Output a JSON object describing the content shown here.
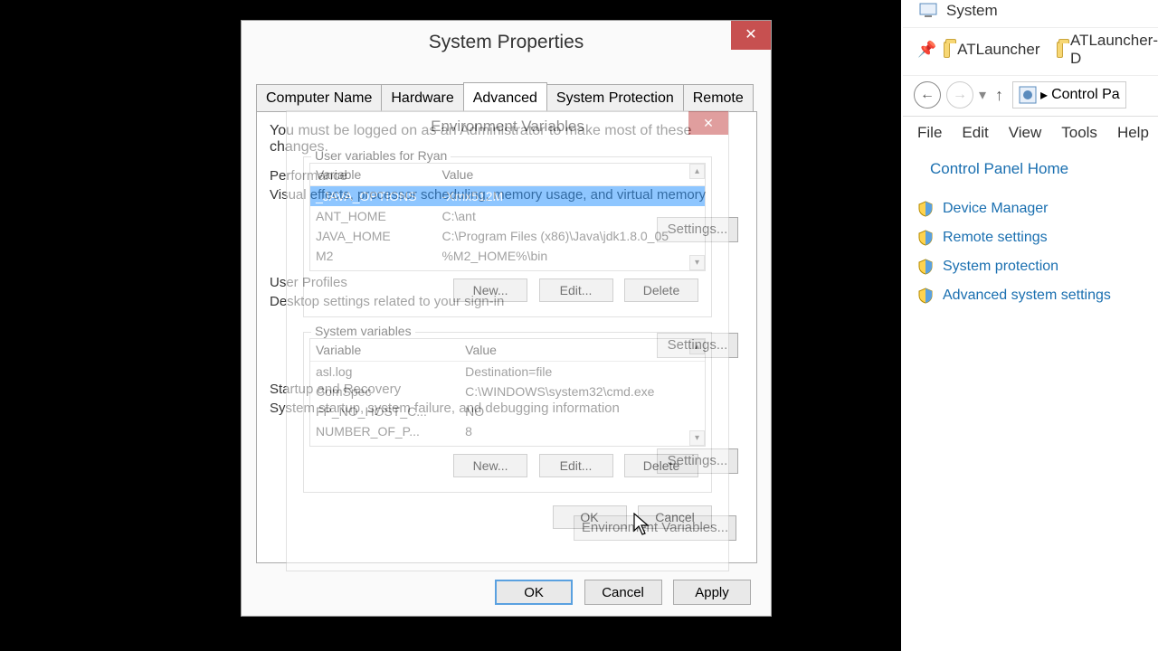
{
  "sysprop": {
    "title": "System Properties",
    "admin_note": "You must be logged on as an Administrator to make most of these changes.",
    "tabs": [
      "Computer Name",
      "Hardware",
      "Advanced",
      "System Protection",
      "Remote"
    ],
    "active_tab": 2,
    "performance": {
      "title": "Performance",
      "desc": "Visual effects, processor scheduling, memory usage, and virtual memory",
      "settings_label": "Settings..."
    },
    "user_profiles": {
      "title": "User Profiles",
      "desc": "Desktop settings related to your sign-in",
      "settings_label": "Settings..."
    },
    "startup": {
      "title": "Startup and Recovery",
      "desc": "System startup, system failure, and debugging information",
      "settings_label": "Settings..."
    },
    "envvar_button": "Environment Variables...",
    "ok": "OK",
    "cancel": "Cancel",
    "apply": "Apply"
  },
  "envdlg": {
    "title": "Environment Variables",
    "user_group_label": "User variables for Ryan",
    "col_variable": "Variable",
    "col_value": "Value",
    "user_vars": [
      {
        "name": "_JAVA_OPTIONS",
        "value": "-Xmx512M"
      },
      {
        "name": "ANT_HOME",
        "value": "C:\\ant"
      },
      {
        "name": "JAVA_HOME",
        "value": "C:\\Program Files (x86)\\Java\\jdk1.8.0_05"
      },
      {
        "name": "M2",
        "value": "%M2_HOME%\\bin"
      }
    ],
    "sys_group_label": "System variables",
    "sys_vars": [
      {
        "name": "asl.log",
        "value": "Destination=file"
      },
      {
        "name": "ComSpec",
        "value": "C:\\WINDOWS\\system32\\cmd.exe"
      },
      {
        "name": "FP_NO_HOST_C...",
        "value": "NO"
      },
      {
        "name": "NUMBER_OF_P...",
        "value": "8"
      }
    ],
    "new": "New...",
    "edit": "Edit...",
    "delete": "Delete",
    "ok": "OK",
    "cancel": "Cancel"
  },
  "explorer": {
    "window_title": "System",
    "pinned": [
      "ATLauncher",
      "ATLauncher-D"
    ],
    "breadcrumb": "Control Pa",
    "menu": [
      "File",
      "Edit",
      "View",
      "Tools",
      "Help"
    ],
    "cp_home": "Control Panel Home",
    "side_links": [
      "Device Manager",
      "Remote settings",
      "System protection",
      "Advanced system settings"
    ]
  }
}
